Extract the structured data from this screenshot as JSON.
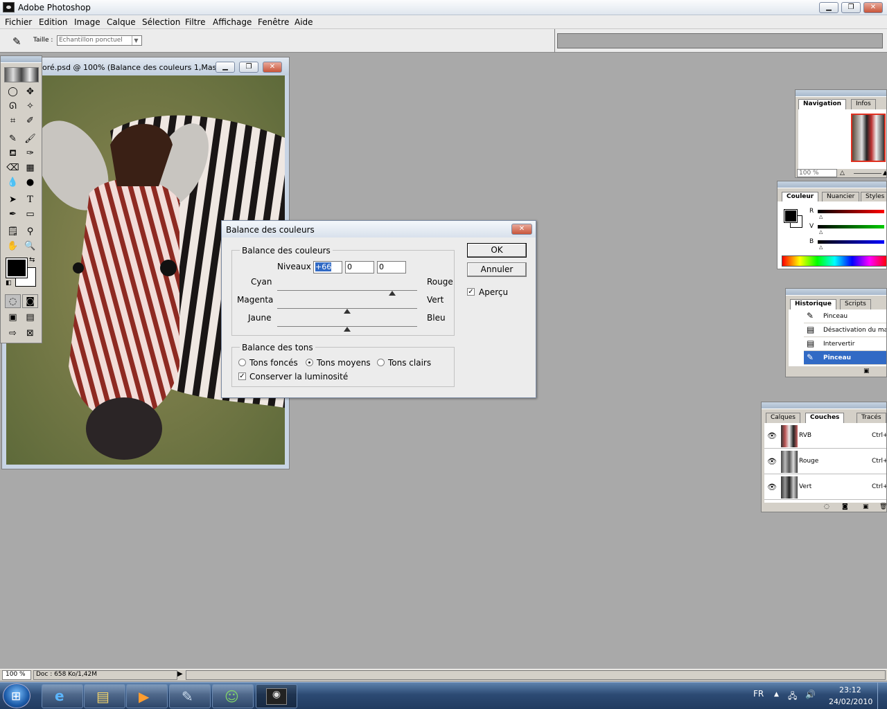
{
  "app": {
    "title": "Adobe Photoshop"
  },
  "menu": [
    "Fichier",
    "Edition",
    "Image",
    "Calque",
    "Sélection",
    "Filtre",
    "Affichage",
    "Fenêtre",
    "Aide"
  ],
  "options": {
    "size_label": "Taille :",
    "size_value": "Echantillon ponctuel"
  },
  "document": {
    "title": "oré.psd @ 100% (Balance des couleurs 1,Mas..."
  },
  "dialog": {
    "title": "Balance des couleurs",
    "group1": "Balance des couleurs",
    "levels_label": "Niveaux :",
    "levels": [
      "+66",
      "0",
      "0"
    ],
    "sliders": [
      {
        "left": "Cyan",
        "right": "Rouge",
        "value": 66
      },
      {
        "left": "Magenta",
        "right": "Vert",
        "value": 0
      },
      {
        "left": "Jaune",
        "right": "Bleu",
        "value": 0
      }
    ],
    "ok": "OK",
    "cancel": "Annuler",
    "preview": "Aperçu",
    "group2": "Balance des tons",
    "tones": [
      "Tons foncés",
      "Tons moyens",
      "Tons clairs"
    ],
    "tones_selected": 1,
    "preserve": "Conserver la luminosité"
  },
  "nav": {
    "tabs": [
      "Navigation",
      "Infos"
    ],
    "zoom": "100 %"
  },
  "color": {
    "tabs": [
      "Couleur",
      "Nuancier",
      "Styles"
    ],
    "channels": [
      "R",
      "V",
      "B"
    ]
  },
  "history": {
    "tabs": [
      "Historique",
      "Scripts"
    ],
    "items": [
      "Pinceau",
      "Désactivation du mas",
      "Intervertir",
      "Pinceau"
    ],
    "selected": 3
  },
  "layers": {
    "tabs": [
      "Calques",
      "Couches",
      "Tracés"
    ],
    "channels": [
      {
        "name": "RVB",
        "key": "Ctrl+"
      },
      {
        "name": "Rouge",
        "key": "Ctrl+"
      },
      {
        "name": "Vert",
        "key": "Ctrl+"
      }
    ]
  },
  "status": {
    "zoom": "100 %",
    "doc": "Doc : 658 Ko/1,42M"
  },
  "taskbar": {
    "lang": "FR",
    "time": "23:12",
    "date": "24/02/2010"
  },
  "colors": {
    "accent": "#316ac5",
    "dialog_bg": "#ececec",
    "workspace": "#a9a9a9"
  }
}
